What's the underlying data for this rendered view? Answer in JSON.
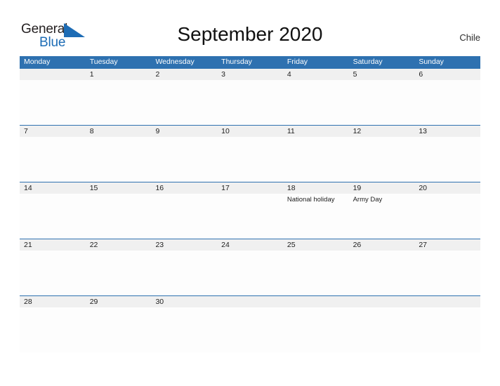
{
  "brand": {
    "name_part1": "General",
    "name_part2": "Blue",
    "triangle_icon": "triangle-icon",
    "accent_color": "#1d6cb5"
  },
  "header": {
    "title": "September 2020",
    "country": "Chile"
  },
  "theme": {
    "header_blue": "#2e71b0",
    "daynum_band": "#f0f0f0",
    "cell_white": "#fdfdfd",
    "text_dark": "#1d1d1d"
  },
  "calendar": {
    "weekdays": [
      "Monday",
      "Tuesday",
      "Wednesday",
      "Thursday",
      "Friday",
      "Saturday",
      "Sunday"
    ],
    "weeks": [
      {
        "days": [
          {
            "num": "",
            "event": ""
          },
          {
            "num": "1",
            "event": ""
          },
          {
            "num": "2",
            "event": ""
          },
          {
            "num": "3",
            "event": ""
          },
          {
            "num": "4",
            "event": ""
          },
          {
            "num": "5",
            "event": ""
          },
          {
            "num": "6",
            "event": ""
          }
        ]
      },
      {
        "days": [
          {
            "num": "7",
            "event": ""
          },
          {
            "num": "8",
            "event": ""
          },
          {
            "num": "9",
            "event": ""
          },
          {
            "num": "10",
            "event": ""
          },
          {
            "num": "11",
            "event": ""
          },
          {
            "num": "12",
            "event": ""
          },
          {
            "num": "13",
            "event": ""
          }
        ]
      },
      {
        "days": [
          {
            "num": "14",
            "event": ""
          },
          {
            "num": "15",
            "event": ""
          },
          {
            "num": "16",
            "event": ""
          },
          {
            "num": "17",
            "event": ""
          },
          {
            "num": "18",
            "event": "National holiday"
          },
          {
            "num": "19",
            "event": "Army Day"
          },
          {
            "num": "20",
            "event": ""
          }
        ]
      },
      {
        "days": [
          {
            "num": "21",
            "event": ""
          },
          {
            "num": "22",
            "event": ""
          },
          {
            "num": "23",
            "event": ""
          },
          {
            "num": "24",
            "event": ""
          },
          {
            "num": "25",
            "event": ""
          },
          {
            "num": "26",
            "event": ""
          },
          {
            "num": "27",
            "event": ""
          }
        ]
      },
      {
        "days": [
          {
            "num": "28",
            "event": ""
          },
          {
            "num": "29",
            "event": ""
          },
          {
            "num": "30",
            "event": ""
          },
          {
            "num": "",
            "event": ""
          },
          {
            "num": "",
            "event": ""
          },
          {
            "num": "",
            "event": ""
          },
          {
            "num": "",
            "event": ""
          }
        ]
      }
    ]
  }
}
